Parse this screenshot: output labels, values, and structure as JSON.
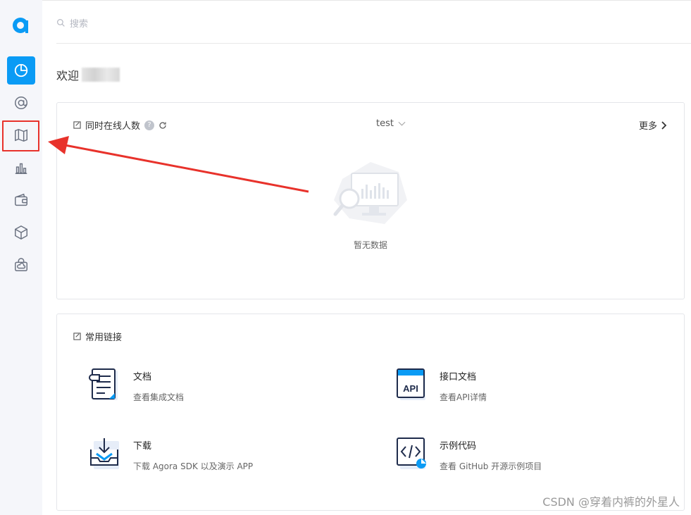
{
  "search": {
    "placeholder": "搜索"
  },
  "welcome": {
    "label": "欢迎"
  },
  "online_card": {
    "title": "同时在线人数",
    "help": "?",
    "project_select": "test",
    "more_label": "更多",
    "empty_text": "暂无数据"
  },
  "links_card": {
    "title": "常用链接",
    "items": [
      {
        "title": "文档",
        "desc": "查看集成文档",
        "icon": "document-icon"
      },
      {
        "title": "接口文档",
        "desc": "查看API详情",
        "icon": "api-icon"
      },
      {
        "title": "下载",
        "desc": "下载 Agora SDK 以及演示 APP",
        "icon": "download-icon"
      },
      {
        "title": "示例代码",
        "desc": "查看 GitHub 开源示例项目",
        "icon": "code-icon"
      }
    ]
  },
  "sidebar": {
    "items": [
      {
        "icon": "dashboard-icon",
        "active": true
      },
      {
        "icon": "at-icon",
        "active": false
      },
      {
        "icon": "map-icon",
        "active": false
      },
      {
        "icon": "bar-chart-icon",
        "active": false
      },
      {
        "icon": "wallet-icon",
        "active": false
      },
      {
        "icon": "cube-icon",
        "active": false
      },
      {
        "icon": "cloud-bag-icon",
        "active": false
      }
    ]
  },
  "api_icon_text": "API",
  "watermark": "CSDN @穿着内裤的外星人",
  "colors": {
    "accent": "#0a9bf5",
    "highlight": "#e8322b"
  }
}
